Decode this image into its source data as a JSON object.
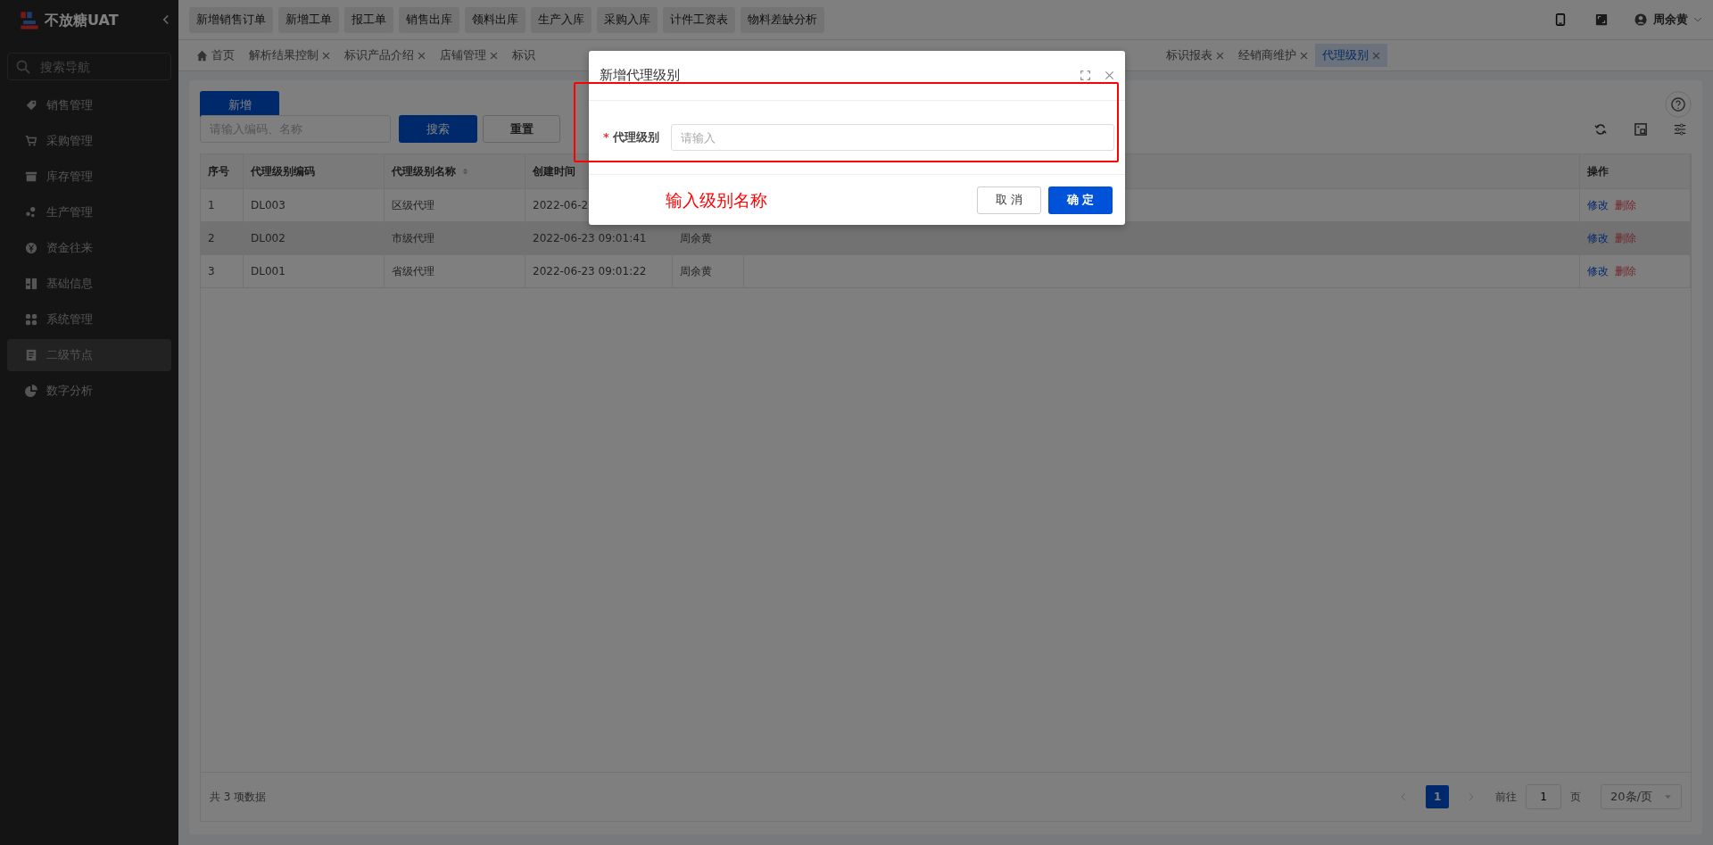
{
  "app": {
    "logo_text": "不放糖UAT"
  },
  "sidebar": {
    "search_placeholder": "搜索导航",
    "items": [
      {
        "label": "销售管理",
        "selected": false
      },
      {
        "label": "采购管理",
        "selected": false
      },
      {
        "label": "库存管理",
        "selected": false
      },
      {
        "label": "生产管理",
        "selected": false
      },
      {
        "label": "资金往来",
        "selected": false
      },
      {
        "label": "基础信息",
        "selected": false
      },
      {
        "label": "系统管理",
        "selected": false
      },
      {
        "label": "二级节点",
        "selected": true
      },
      {
        "label": "数字分析",
        "selected": false
      }
    ]
  },
  "quick_actions": [
    "新增销售订单",
    "新增工单",
    "报工单",
    "销售出库",
    "领料出库",
    "生产入库",
    "采购入库",
    "计件工资表",
    "物料差缺分析"
  ],
  "user": {
    "name": "周余黄"
  },
  "tabs_left": [
    {
      "label": "首页",
      "home": true,
      "closable": false,
      "selected": false
    },
    {
      "label": "解析结果控制",
      "home": false,
      "closable": true,
      "selected": false
    },
    {
      "label": "标识产品介绍",
      "home": false,
      "closable": true,
      "selected": false
    },
    {
      "label": "店铺管理",
      "home": false,
      "closable": true,
      "selected": false
    },
    {
      "label": "标识",
      "home": false,
      "closable": false,
      "selected": false
    }
  ],
  "tabs_right": [
    {
      "label": "标识报表",
      "home": false,
      "closable": true,
      "selected": false
    },
    {
      "label": "经销商维护",
      "home": false,
      "closable": true,
      "selected": false
    },
    {
      "label": "代理级别",
      "home": false,
      "closable": true,
      "selected": true
    }
  ],
  "toolbar": {
    "add_button": "新增",
    "search_placeholder": "请输入编码、名称",
    "search_button": "搜索",
    "reset_button": "重置"
  },
  "table": {
    "columns": [
      {
        "label": "序号",
        "sortable": false
      },
      {
        "label": "代理级别编码",
        "sortable": false
      },
      {
        "label": "代理级别名称",
        "sortable": true
      },
      {
        "label": "创建时间",
        "sortable": false
      },
      {
        "label": "操作",
        "sortable": false
      }
    ],
    "rows": [
      {
        "selected": false,
        "cells": [
          "1",
          "DL003",
          "区级代理",
          "2022-06-2"
        ],
        "actions": [
          "修改",
          "删除"
        ]
      },
      {
        "selected": true,
        "cells": [
          "2",
          "DL002",
          "市级代理",
          "2022-06-23 09:01:41",
          "周余黄"
        ],
        "actions": [
          "修改",
          "删除"
        ]
      },
      {
        "selected": false,
        "cells": [
          "3",
          "DL001",
          "省级代理",
          "2022-06-23 09:01:22",
          "周余黄"
        ],
        "actions": [
          "修改",
          "删除"
        ]
      }
    ]
  },
  "footer": {
    "total": "共 3 项数据",
    "pages": [
      {
        "label": "1",
        "selected": true
      }
    ],
    "goto_label": "前往",
    "goto_value": "1",
    "page_unit": "页",
    "page_size": "20条/页"
  },
  "dialog": {
    "title": "新增代理级别",
    "fields": [
      {
        "label": "代理级别",
        "required_mark": "*",
        "placeholder": "请输入"
      }
    ],
    "cancel": "取 消",
    "ok": "确 定"
  },
  "annotation": {
    "text": "输入级别名称"
  }
}
